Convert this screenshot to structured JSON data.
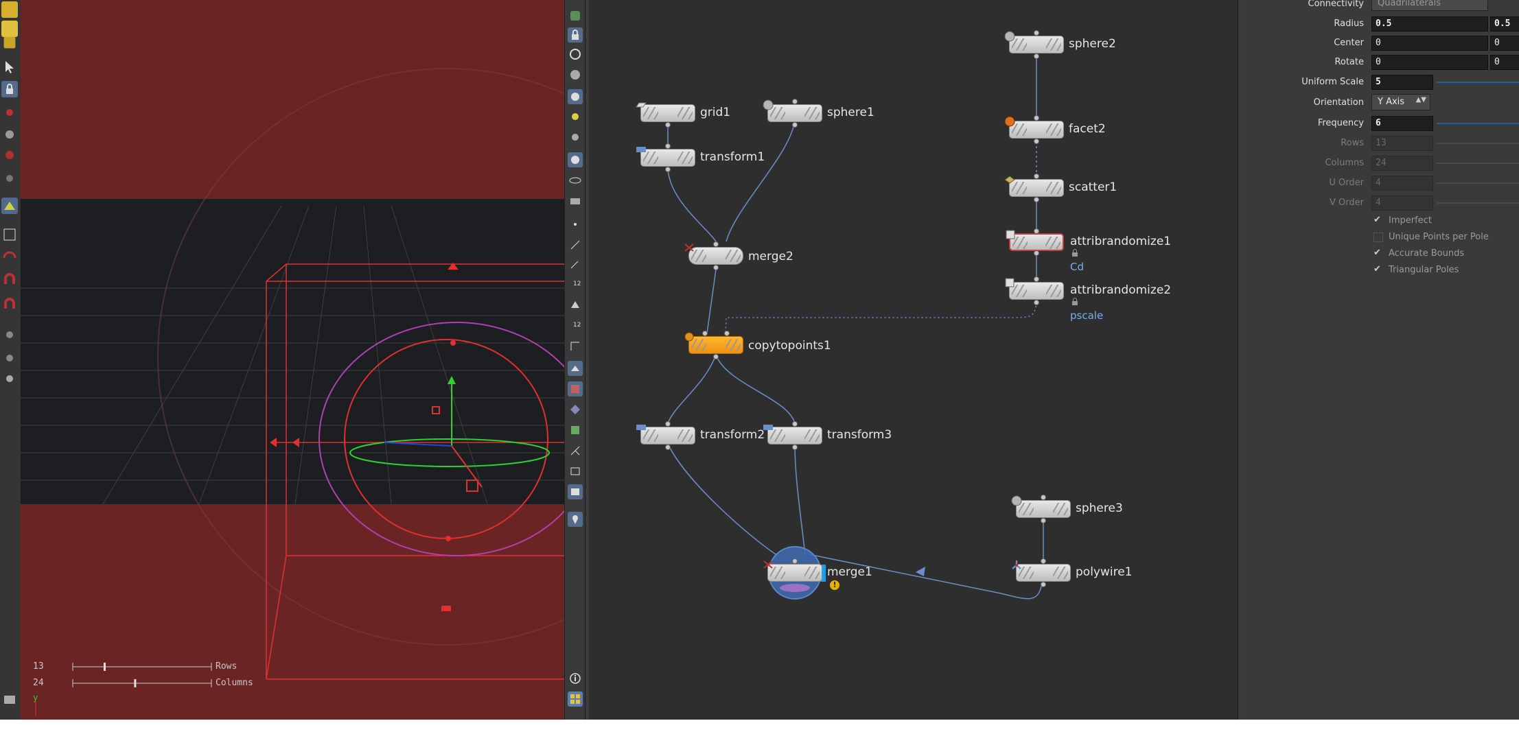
{
  "viewport": {
    "rows_value": "13",
    "rows_label": "Rows",
    "columns_value": "24",
    "columns_label": "Columns",
    "rows_slider_fraction": 0.23,
    "columns_slider_fraction": 0.45,
    "axis_label": "y"
  },
  "network": {
    "nodes": [
      {
        "id": "grid1",
        "label": "grid1",
        "icon": "grid-icon"
      },
      {
        "id": "sphere1",
        "label": "sphere1",
        "icon": "sphere-icon"
      },
      {
        "id": "transform1",
        "label": "transform1",
        "icon": "transform-icon"
      },
      {
        "id": "merge2",
        "label": "merge2",
        "icon": "merge-icon"
      },
      {
        "id": "copytopoints1",
        "label": "copytopoints1",
        "icon": "copy-icon"
      },
      {
        "id": "transform2",
        "label": "transform2",
        "icon": "transform-icon"
      },
      {
        "id": "transform3",
        "label": "transform3",
        "icon": "transform-icon"
      },
      {
        "id": "merge1",
        "label": "merge1",
        "icon": "merge-icon"
      },
      {
        "id": "sphere2",
        "label": "sphere2",
        "icon": "sphere-icon"
      },
      {
        "id": "facet2",
        "label": "facet2",
        "icon": "facet-icon"
      },
      {
        "id": "scatter1",
        "label": "scatter1",
        "icon": "scatter-icon"
      },
      {
        "id": "attribrandomize1",
        "label": "attribrandomize1",
        "icon": "attrib-icon",
        "sub": "Cd"
      },
      {
        "id": "attribrandomize2",
        "label": "attribrandomize2",
        "icon": "attrib-icon",
        "sub": "pscale"
      },
      {
        "id": "sphere3",
        "label": "sphere3",
        "icon": "sphere-icon"
      },
      {
        "id": "polywire1",
        "label": "polywire1",
        "icon": "polywire-icon"
      }
    ],
    "colors": {
      "wire": "#6a8fc8",
      "selected_node": "#f0a020",
      "sub_label": "#7aaef0"
    }
  },
  "params": {
    "connectivity_label": "Connectivity",
    "connectivity_value": "Quadrilaterals",
    "radius_label": "Radius",
    "radius_x": "0.5",
    "radius_y": "0.5",
    "center_label": "Center",
    "center_x": "0",
    "center_y": "0",
    "rotate_label": "Rotate",
    "rotate_x": "0",
    "rotate_y": "0",
    "uniform_scale_label": "Uniform Scale",
    "uniform_scale_value": "5",
    "orientation_label": "Orientation",
    "orientation_value": "Y Axis",
    "frequency_label": "Frequency",
    "frequency_value": "6",
    "rows_label": "Rows",
    "rows_value": "13",
    "columns_label": "Columns",
    "columns_value": "24",
    "u_order_label": "U Order",
    "u_order_value": "4",
    "v_order_label": "V Order",
    "v_order_value": "4",
    "imperfect_label": "Imperfect",
    "unique_points_label": "Unique Points per Pole",
    "accurate_bounds_label": "Accurate Bounds",
    "triangular_poles_label": "Triangular Poles"
  }
}
